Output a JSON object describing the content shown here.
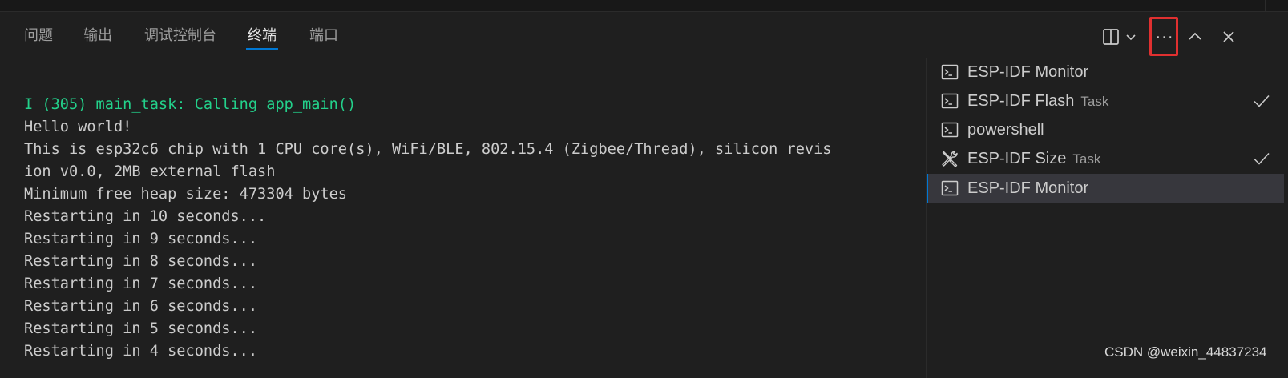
{
  "panel": {
    "tabs": [
      {
        "label": "问题",
        "active": false
      },
      {
        "label": "输出",
        "active": false
      },
      {
        "label": "调试控制台",
        "active": false
      },
      {
        "label": "终端",
        "active": true
      },
      {
        "label": "端口",
        "active": false
      }
    ],
    "actions": [
      {
        "icon": "split-terminal-icon"
      },
      {
        "icon": "chevron-down-icon"
      },
      {
        "icon": "more-actions-icon",
        "glyph": "···"
      },
      {
        "icon": "maximize-panel-icon"
      },
      {
        "icon": "close-panel-icon"
      }
    ],
    "highlight_color": "#e03030",
    "accent_color": "#0078d4"
  },
  "terminal": {
    "lines": [
      "I (305) main_task: Calling app_main()",
      "Hello world!",
      "This is esp32c6 chip with 1 CPU core(s), WiFi/BLE, 802.15.4 (Zigbee/Thread), silicon revis",
      "ion v0.0, 2MB external flash",
      "Minimum free heap size: 473304 bytes",
      "Restarting in 10 seconds...",
      "Restarting in 9 seconds...",
      "Restarting in 8 seconds...",
      "Restarting in 7 seconds...",
      "Restarting in 6 seconds...",
      "Restarting in 5 seconds...",
      "Restarting in 4 seconds..."
    ],
    "log_info_color": "#23d18b"
  },
  "terminal_list": [
    {
      "name": "ESP-IDF Monitor",
      "kind": "",
      "icon": "terminal-icon",
      "checked": false,
      "selected": false
    },
    {
      "name": "ESP-IDF Flash",
      "kind": "Task",
      "icon": "terminal-icon",
      "checked": true,
      "selected": false
    },
    {
      "name": "powershell",
      "kind": "",
      "icon": "terminal-icon",
      "checked": false,
      "selected": false
    },
    {
      "name": "ESP-IDF Size",
      "kind": "Task",
      "icon": "tools-icon",
      "checked": true,
      "selected": false
    },
    {
      "name": "ESP-IDF Monitor",
      "kind": "",
      "icon": "terminal-icon",
      "checked": false,
      "selected": true
    }
  ],
  "watermark": "CSDN @weixin_44837234"
}
